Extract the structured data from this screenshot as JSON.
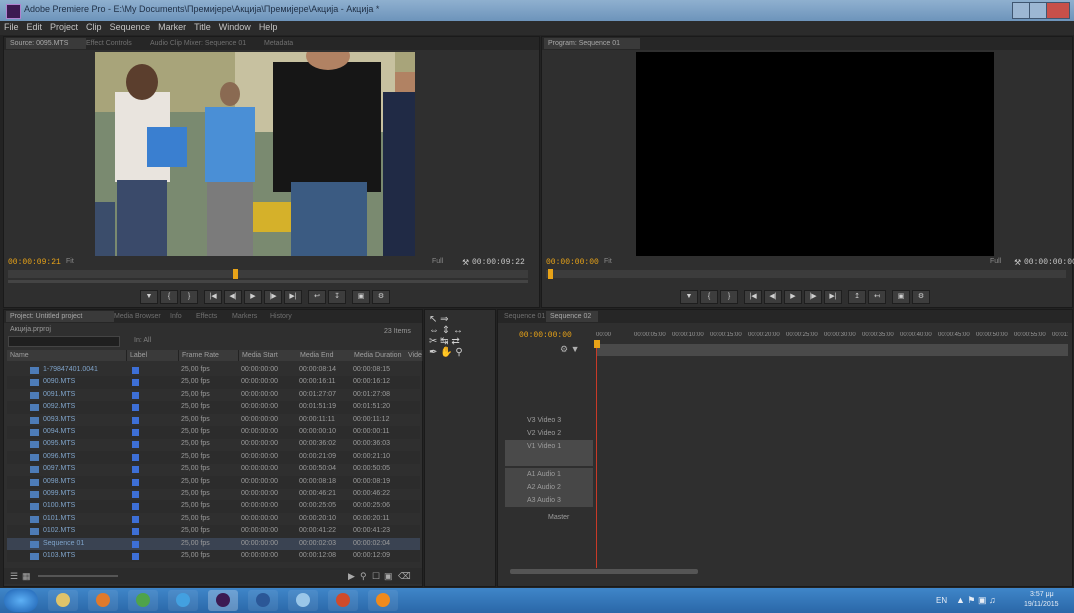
{
  "window": {
    "title": "Adobe Premiere Pro - E:\\My Documents\\Премијере\\Акција\\Премијере\\Акција - Акција *"
  },
  "menu": [
    "File",
    "Edit",
    "Project",
    "Clip",
    "Sequence",
    "Marker",
    "Title",
    "Window",
    "Help"
  ],
  "source_monitor": {
    "tabs": [
      "Source: 0095.MTS",
      "Effect Controls",
      "Audio Clip Mixer: Sequence 01",
      "Metadata"
    ],
    "timecode_in": "00:00:09:21",
    "fit": "Fit",
    "timecode_out": "00:00:09:22",
    "full": "Full"
  },
  "program_monitor": {
    "tabs": [
      "Program: Sequence 01"
    ],
    "timecode_in": "00:00:00:00",
    "fit": "Fit",
    "timecode_out": "00:00:00:00",
    "full": "Full"
  },
  "project": {
    "tabs": [
      "Project: Untitled project",
      "Media Browser",
      "Info",
      "Effects",
      "Markers",
      "History"
    ],
    "name": "Акција.prproj",
    "items_count": "23 Items",
    "in_label": "In: All",
    "columns": [
      "Name",
      "Label",
      "Frame Rate",
      "Media Start",
      "Media End",
      "Media Duration",
      "Video"
    ],
    "rows": [
      {
        "name": "1-79847401.0041",
        "fr": "25,00 fps",
        "ms": "00:00:00:00",
        "me": "00:00:08:14",
        "md": "00:00:08:15"
      },
      {
        "name": "0090.MTS",
        "fr": "25,00 fps",
        "ms": "00:00:00:00",
        "me": "00:00:16:11",
        "md": "00:00:16:12"
      },
      {
        "name": "0091.MTS",
        "fr": "25,00 fps",
        "ms": "00:00:00:00",
        "me": "00:01:27:07",
        "md": "00:01:27:08"
      },
      {
        "name": "0092.MTS",
        "fr": "25,00 fps",
        "ms": "00:00:00:00",
        "me": "00:01:51:19",
        "md": "00:01:51:20"
      },
      {
        "name": "0093.MTS",
        "fr": "25,00 fps",
        "ms": "00:00:00:00",
        "me": "00:00:11:11",
        "md": "00:00:11:12"
      },
      {
        "name": "0094.MTS",
        "fr": "25,00 fps",
        "ms": "00:00:00:00",
        "me": "00:00:00:10",
        "md": "00:00:00:11"
      },
      {
        "name": "0095.MTS",
        "fr": "25,00 fps",
        "ms": "00:00:00:00",
        "me": "00:00:36:02",
        "md": "00:00:36:03"
      },
      {
        "name": "0096.MTS",
        "fr": "25,00 fps",
        "ms": "00:00:00:00",
        "me": "00:00:21:09",
        "md": "00:00:21:10"
      },
      {
        "name": "0097.MTS",
        "fr": "25,00 fps",
        "ms": "00:00:00:00",
        "me": "00:00:50:04",
        "md": "00:00:50:05"
      },
      {
        "name": "0098.MTS",
        "fr": "25,00 fps",
        "ms": "00:00:00:00",
        "me": "00:00:08:18",
        "md": "00:00:08:19"
      },
      {
        "name": "0099.MTS",
        "fr": "25,00 fps",
        "ms": "00:00:00:00",
        "me": "00:00:46:21",
        "md": "00:00:46:22"
      },
      {
        "name": "0100.MTS",
        "fr": "25,00 fps",
        "ms": "00:00:00:00",
        "me": "00:00:25:05",
        "md": "00:00:25:06"
      },
      {
        "name": "0101.MTS",
        "fr": "25,00 fps",
        "ms": "00:00:00:00",
        "me": "00:00:20:10",
        "md": "00:00:20:11"
      },
      {
        "name": "0102.MTS",
        "fr": "25,00 fps",
        "ms": "00:00:00:00",
        "me": "00:00:41:22",
        "md": "00:00:41:23"
      },
      {
        "name": "Sequence 01",
        "fr": "25,00 fps",
        "ms": "00:00:00:00",
        "me": "00:00:02:03",
        "md": "00:00:02:04"
      },
      {
        "name": "0103.MTS",
        "fr": "25,00 fps",
        "ms": "00:00:00:00",
        "me": "00:00:12:08",
        "md": "00:00:12:09"
      }
    ]
  },
  "timeline": {
    "tabs": [
      "Sequence 01",
      "Sequence 02"
    ],
    "timecode": "00:00:00:00",
    "ruler": [
      "00:00",
      "00:00:05:00",
      "00:00:10:00",
      "00:00:15:00",
      "00:00:20:00",
      "00:00:25:00",
      "00:00:30:00",
      "00:00:35:00",
      "00:00:40:00",
      "00:00:45:00",
      "00:00:50:00",
      "00:00:55:00",
      "00:01:00:00"
    ],
    "tracks": [
      {
        "label": "V3  Video 3",
        "kind": "v"
      },
      {
        "label": "V2  Video 2",
        "kind": "v"
      },
      {
        "label": "V1  Video 1",
        "kind": "hl"
      },
      {
        "label": "",
        "kind": "hl"
      },
      {
        "label": "A1  Audio 1",
        "kind": "a"
      },
      {
        "label": "A2  Audio 2",
        "kind": "a"
      },
      {
        "label": "A3  Audio 3",
        "kind": "a"
      },
      {
        "label": "Master",
        "kind": "m"
      }
    ]
  },
  "taskbar": {
    "lang": "EN",
    "time": "3:57 μμ",
    "date": "19/11/2015",
    "apps": [
      "explorer",
      "firefox",
      "utorrent",
      "chrome",
      "premiere",
      "word",
      "paint",
      "office",
      "vlc"
    ]
  }
}
